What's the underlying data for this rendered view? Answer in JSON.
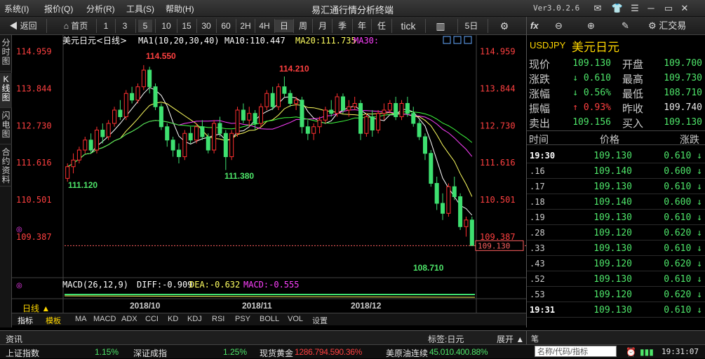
{
  "menubar": {
    "items": [
      "系统(I)",
      "报价(Q)",
      "分析(R)",
      "工具(S)",
      "帮助(H)"
    ],
    "title": "易汇通行情分析终端",
    "version": "Ver3.0.2.6"
  },
  "toolbar": {
    "back": "返回",
    "home": "首页",
    "periods": [
      "1",
      "3",
      "5",
      "10",
      "15",
      "30",
      "60",
      "2H",
      "4H",
      "日",
      "周",
      "月",
      "季",
      "年",
      "任",
      "tick"
    ],
    "five_day": "5日",
    "right_items": {
      "trade": "汇交易"
    }
  },
  "sidetabs": [
    "分时图",
    "K线图",
    "闪电图",
    "合约资料"
  ],
  "chart_data": {
    "type": "candlestick",
    "title": "美元日元<日线>",
    "ma_legend": {
      "ma1": "MA1(10,20,30,40)",
      "ma10": "MA10:110.447",
      "ma20": "MA20:111.735",
      "ma30": "MA30:"
    },
    "y_ticks": [
      "114.959",
      "113.844",
      "112.730",
      "111.616",
      "110.501",
      "109.387"
    ],
    "ylim": [
      108.4,
      115.2
    ],
    "x_labels": [
      "2018/10",
      "2018/11",
      "2018/12"
    ],
    "annotations": {
      "high": "114.550",
      "low1": "111.120",
      "low2": "111.380",
      "high2": "114.210",
      "low3": "108.710"
    },
    "current_price": "109.130",
    "candles": [
      [
        111.15,
        111.6,
        111.05,
        111.5
      ],
      [
        111.5,
        111.9,
        111.3,
        111.7
      ],
      [
        111.7,
        112.1,
        111.6,
        112.0
      ],
      [
        112.0,
        112.4,
        111.9,
        112.3
      ],
      [
        112.3,
        112.5,
        111.9,
        112.0
      ],
      [
        112.0,
        112.7,
        111.9,
        112.6
      ],
      [
        112.6,
        112.8,
        112.2,
        112.4
      ],
      [
        112.4,
        112.9,
        112.3,
        112.8
      ],
      [
        112.8,
        113.3,
        112.7,
        113.2
      ],
      [
        113.2,
        113.5,
        112.9,
        113.0
      ],
      [
        113.0,
        113.8,
        112.9,
        113.7
      ],
      [
        113.7,
        113.9,
        113.4,
        113.5
      ],
      [
        113.5,
        114.0,
        113.4,
        113.9
      ],
      [
        113.9,
        114.55,
        113.8,
        114.4
      ],
      [
        114.4,
        114.5,
        113.7,
        113.9
      ],
      [
        113.9,
        114.0,
        113.2,
        113.3
      ],
      [
        113.3,
        113.4,
        112.6,
        112.7
      ],
      [
        112.7,
        112.8,
        112.1,
        112.3
      ],
      [
        112.3,
        112.4,
        111.8,
        112.0
      ],
      [
        112.0,
        112.2,
        111.6,
        111.8
      ],
      [
        111.8,
        112.6,
        111.7,
        112.5
      ],
      [
        112.5,
        112.7,
        112.2,
        112.3
      ],
      [
        112.3,
        112.8,
        112.2,
        112.7
      ],
      [
        112.7,
        112.9,
        112.3,
        112.4
      ],
      [
        112.4,
        112.5,
        111.9,
        112.0
      ],
      [
        112.0,
        112.9,
        111.9,
        112.8
      ],
      [
        112.8,
        113.0,
        112.4,
        112.5
      ],
      [
        112.5,
        112.6,
        111.4,
        111.8
      ],
      [
        111.8,
        112.6,
        111.7,
        112.5
      ],
      [
        112.5,
        113.3,
        112.4,
        113.2
      ],
      [
        113.2,
        113.4,
        112.8,
        112.9
      ],
      [
        112.9,
        113.3,
        112.7,
        113.1
      ],
      [
        113.1,
        113.2,
        112.6,
        112.8
      ],
      [
        112.8,
        113.4,
        112.7,
        113.3
      ],
      [
        113.3,
        113.8,
        113.2,
        113.7
      ],
      [
        113.7,
        113.9,
        113.2,
        113.3
      ],
      [
        113.3,
        114.0,
        113.2,
        113.9
      ],
      [
        113.9,
        114.21,
        113.6,
        113.7
      ],
      [
        113.7,
        113.8,
        113.3,
        113.4
      ],
      [
        113.4,
        113.6,
        113.2,
        113.5
      ],
      [
        113.5,
        113.6,
        112.5,
        112.7
      ],
      [
        112.7,
        112.9,
        112.3,
        112.5
      ],
      [
        112.5,
        112.8,
        112.3,
        112.7
      ],
      [
        112.7,
        113.0,
        112.5,
        112.9
      ],
      [
        112.9,
        113.3,
        112.8,
        113.2
      ],
      [
        113.2,
        113.5,
        113.0,
        113.1
      ],
      [
        113.1,
        113.7,
        113.0,
        113.6
      ],
      [
        113.6,
        113.7,
        113.1,
        113.2
      ],
      [
        113.2,
        113.5,
        113.0,
        113.3
      ],
      [
        113.3,
        113.6,
        113.2,
        113.4
      ],
      [
        113.4,
        113.5,
        112.3,
        112.5
      ],
      [
        112.5,
        113.1,
        112.4,
        113.0
      ],
      [
        113.0,
        113.2,
        112.4,
        112.6
      ],
      [
        112.6,
        113.2,
        112.5,
        113.1
      ],
      [
        113.1,
        113.4,
        112.9,
        113.2
      ],
      [
        113.2,
        113.5,
        113.1,
        113.4
      ],
      [
        113.4,
        113.6,
        112.9,
        113.0
      ],
      [
        113.0,
        113.5,
        112.9,
        113.4
      ],
      [
        113.4,
        113.6,
        113.0,
        113.1
      ],
      [
        113.1,
        113.3,
        112.7,
        112.8
      ],
      [
        112.8,
        112.9,
        112.3,
        112.4
      ],
      [
        112.4,
        112.5,
        111.7,
        111.9
      ],
      [
        111.9,
        112.0,
        110.9,
        111.0
      ],
      [
        111.0,
        111.2,
        110.2,
        110.4
      ],
      [
        110.4,
        110.7,
        109.9,
        110.1
      ],
      [
        110.1,
        111.0,
        110.0,
        110.9
      ],
      [
        110.9,
        111.2,
        110.5,
        110.6
      ],
      [
        110.6,
        110.7,
        109.6,
        109.7
      ],
      [
        109.7,
        110.0,
        109.4,
        109.9
      ],
      [
        109.9,
        110.0,
        109.3,
        109.13
      ]
    ],
    "macd": {
      "label": "MACD(26,12,9)",
      "diff": "DIFF:-0.909",
      "dea": "DEA:-0.632",
      "macd": "MACD:-0.555"
    }
  },
  "indicator_tabs": [
    "日线 ▲",
    "指标",
    "模板",
    "MA",
    "MACD",
    "ADX",
    "CCI",
    "KD",
    "KDJ",
    "RSI",
    "PSY",
    "BOLL",
    "VOL",
    "设置"
  ],
  "quote": {
    "symbol": "USDJPY",
    "name": "美元日元",
    "rows": [
      {
        "l": "现价",
        "v": "109.130",
        "vc": "green",
        "l2": "开盘",
        "v2": "109.700",
        "v2c": "green"
      },
      {
        "l": "涨跌",
        "v": "↓ 0.610",
        "vc": "green",
        "l2": "最高",
        "v2": "109.730",
        "v2c": "green"
      },
      {
        "l": "涨幅",
        "v": "↓ 0.56%",
        "vc": "green",
        "l2": "最低",
        "v2": "108.710",
        "v2c": "green"
      },
      {
        "l": "振幅",
        "v": "↑ 0.93%",
        "vc": "red",
        "l2": "昨收",
        "v2": "109.740",
        "v2c": "white"
      },
      {
        "l": "卖出",
        "v": "109.156",
        "vc": "green",
        "l2": "买入",
        "v2": "109.130",
        "v2c": "green"
      }
    ],
    "tick_header": {
      "time": "时间",
      "price": "价格",
      "change": "涨跌"
    },
    "ticks": [
      {
        "t": "19:30",
        "p": "109.130",
        "c": "0.610 ↓"
      },
      {
        "t": ".16",
        "p": "109.140",
        "c": "0.600 ↓"
      },
      {
        "t": ".17",
        "p": "109.130",
        "c": "0.610 ↓"
      },
      {
        "t": ".18",
        "p": "109.140",
        "c": "0.600 ↓"
      },
      {
        "t": ".19",
        "p": "109.130",
        "c": "0.610 ↓"
      },
      {
        "t": ".28",
        "p": "109.120",
        "c": "0.620 ↓"
      },
      {
        "t": ".33",
        "p": "109.130",
        "c": "0.610 ↓"
      },
      {
        "t": ".43",
        "p": "109.120",
        "c": "0.620 ↓"
      },
      {
        "t": ".52",
        "p": "109.130",
        "c": "0.610 ↓"
      },
      {
        "t": ".53",
        "p": "109.120",
        "c": "0.620 ↓"
      },
      {
        "t": "19:31",
        "p": "109.130",
        "c": "0.610 ↓"
      }
    ]
  },
  "infobar": {
    "left": "资讯",
    "tag": "标签:日元",
    "expand": "展开",
    "right": "笔"
  },
  "statusbar": {
    "items": [
      {
        "name": "上证指数",
        "val": "1.15%"
      },
      {
        "name": "深证成指",
        "val": "1.25%"
      },
      {
        "name": "现货黄金",
        "val": "1286.794.590.36%"
      },
      {
        "name": "美原油连续",
        "val": "45.010.400.88%"
      }
    ],
    "search_placeholder": "名称/代码/指标",
    "clock": "19:31:07"
  }
}
